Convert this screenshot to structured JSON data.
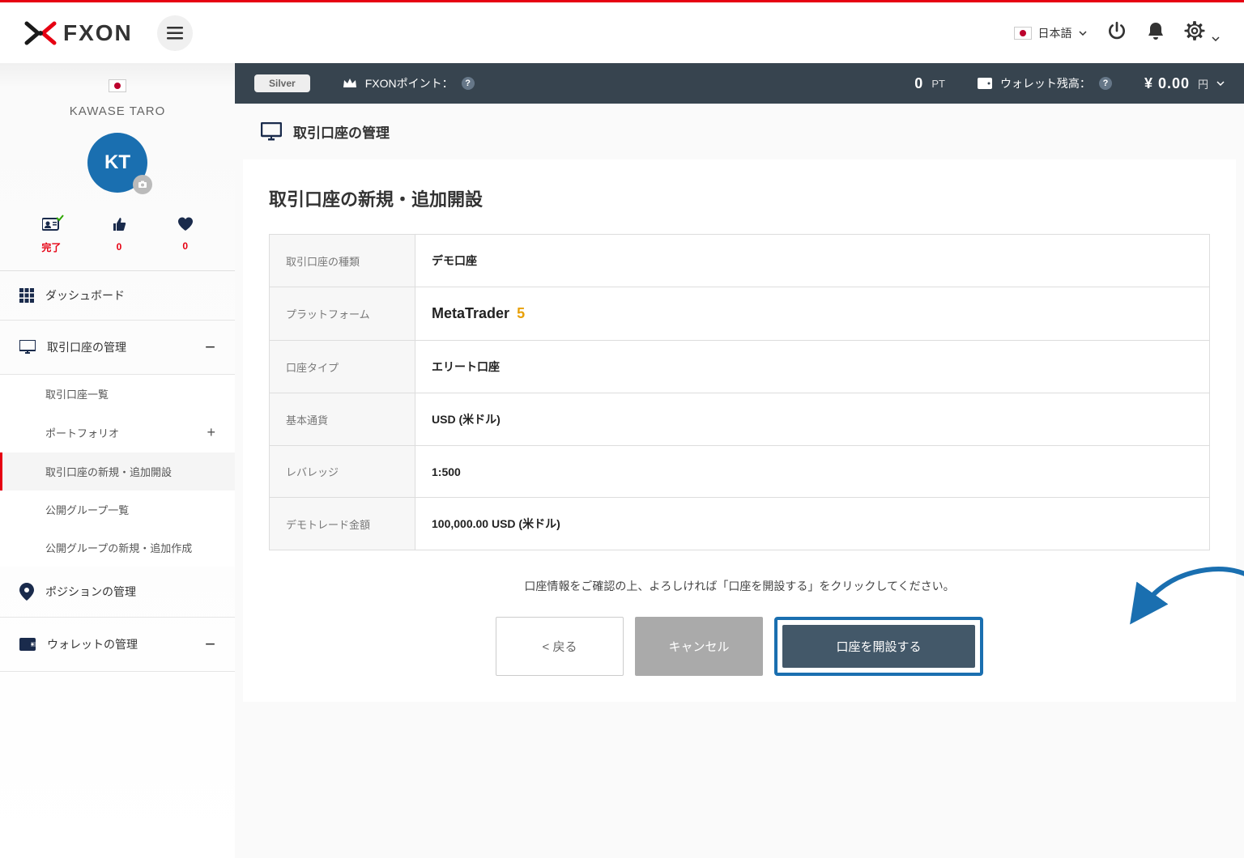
{
  "header": {
    "logo_text": "FXON",
    "lang_label": "日本語"
  },
  "status_bar": {
    "badge": "Silver",
    "points_label": "FXONポイント：",
    "points_value": "0",
    "points_unit": "PT",
    "wallet_label": "ウォレット残高：",
    "wallet_value": "¥ 0.00",
    "wallet_unit": "円"
  },
  "sidebar": {
    "profile_name": "KAWASE TARO",
    "avatar_initials": "KT",
    "stats": {
      "complete_label": "完了",
      "likes_value": "0",
      "favorites_value": "0"
    },
    "nav": {
      "dashboard": "ダッシュボード",
      "accounts": "取引口座の管理",
      "accounts_sub": {
        "list": "取引口座一覧",
        "portfolio": "ポートフォリオ",
        "new_account": "取引口座の新規・追加開設",
        "public_groups": "公開グループ一覧",
        "create_group": "公開グループの新規・追加作成"
      },
      "positions": "ポジションの管理",
      "wallet": "ウォレットの管理"
    }
  },
  "page": {
    "header_title": "取引口座の管理",
    "card_title": "取引口座の新規・追加開設",
    "table": {
      "row1_label": "取引口座の種類",
      "row1_value": "デモ口座",
      "row2_label": "プラットフォーム",
      "row2_value_main": "MetaTrader",
      "row2_value_num": "5",
      "row3_label": "口座タイプ",
      "row3_value": "エリート口座",
      "row4_label": "基本通貨",
      "row4_value": "USD (米ドル)",
      "row5_label": "レバレッジ",
      "row5_value": "1:500",
      "row6_label": "デモトレード金額",
      "row6_value": "100,000.00  USD (米ドル)"
    },
    "confirm_text": "口座情報をご確認の上、よろしければ「口座を開設する」をクリックしてください。",
    "buttons": {
      "back": "< 戻る",
      "cancel": "キャンセル",
      "submit": "口座を開設する"
    }
  }
}
